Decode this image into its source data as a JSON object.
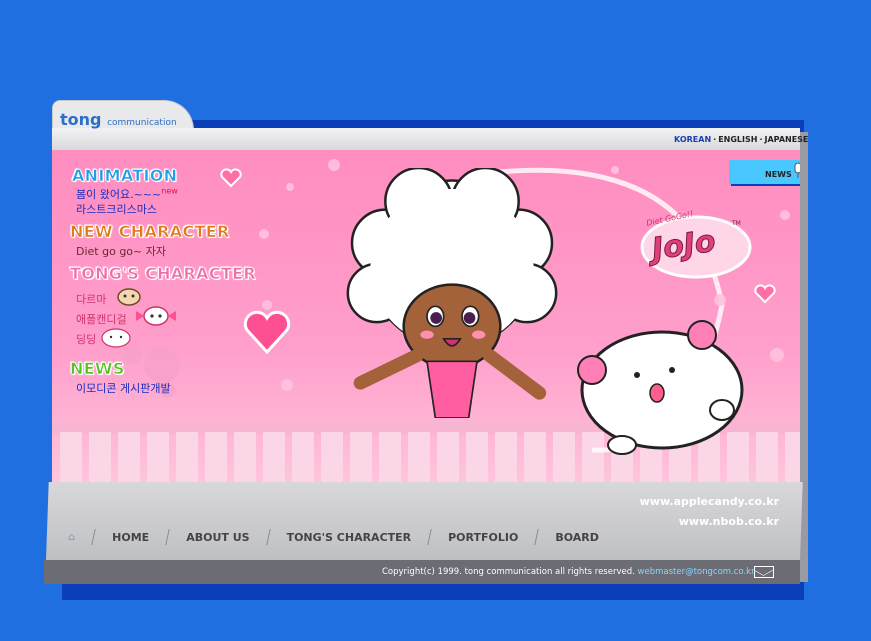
{
  "header": {
    "logo_main": "tong",
    "logo_sub": "communication",
    "languages": [
      "KOREAN",
      "ENGLISH",
      "JAPANESE"
    ],
    "news_button": "NEWS"
  },
  "menu": {
    "animation": {
      "title": "ANIMATION",
      "items": [
        "봄이 왔어요.~~~",
        "라스트크리스마스"
      ],
      "new_badge": "new"
    },
    "new_character": {
      "title": "NEW CHARACTER",
      "items": [
        "Diet go go~ 자자"
      ]
    },
    "tongs_character": {
      "title": "TONG'S CHARACTER",
      "items": [
        "다르마",
        "애플캔디걸",
        "딩딩"
      ]
    },
    "news": {
      "title": "NEWS",
      "items": [
        "이모디콘 게시판개발"
      ]
    }
  },
  "brand_badge": {
    "line1": "Diet GoGo!!",
    "line2": "JoJo",
    "mark": "TM"
  },
  "footer": {
    "urls": [
      "www.applecandy.co.kr",
      "www.nbob.co.kr"
    ],
    "nav": [
      "HOME",
      "ABOUT US",
      "TONG'S CHARACTER",
      "PORTFOLIO",
      "BOARD"
    ],
    "copyright": "Copyright(c) 1999. tong communication all rights reserved.",
    "email": "webmaster@tongcom.co.kr"
  },
  "colors": {
    "background": "#1f6fe0",
    "canvas_pink": "#ff9fcb",
    "footer_grey": "#c8c9cc",
    "animation_heading": "#1aa0e8",
    "new_char_heading": "#e07a1a",
    "tongs_heading": "#f06ea8",
    "news_heading": "#55c41c"
  }
}
